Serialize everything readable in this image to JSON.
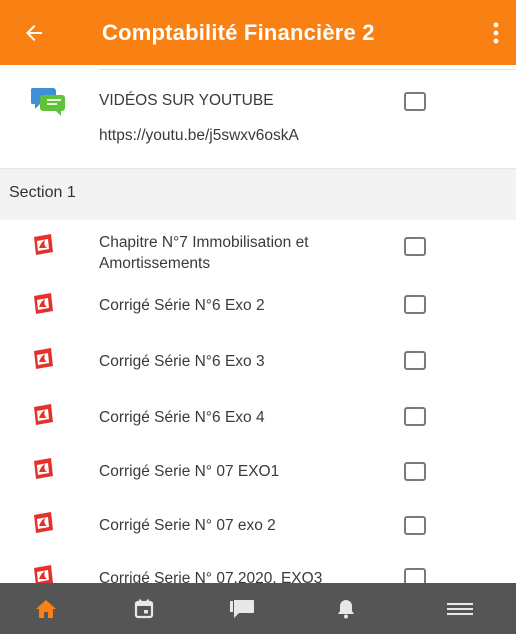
{
  "header": {
    "title": "Comptabilité Financière 2"
  },
  "colors": {
    "accent": "#f98012",
    "nav_bg": "#555555",
    "nav_active": "#f98012",
    "nav_inactive": "#e8e8e8"
  },
  "top_item": {
    "icon": "chat-bubbles-icon",
    "title": "VIDÉOS SUR YOUTUBE",
    "url": "https://youtu.be/j5swxv6oskA"
  },
  "section": {
    "label": "Section 1"
  },
  "items": [
    {
      "icon": "pdf-icon",
      "title": "Chapitre N°7 Immobilisation et Amortissements"
    },
    {
      "icon": "pdf-icon",
      "title": "Corrigé Série N°6 Exo 2"
    },
    {
      "icon": "pdf-icon",
      "title": "Corrigé Série N°6 Exo 3"
    },
    {
      "icon": "pdf-icon",
      "title": "Corrigé Série N°6 Exo 4"
    },
    {
      "icon": "pdf-icon",
      "title": "Corrigé Serie N° 07 EXO1"
    },
    {
      "icon": "pdf-icon",
      "title": "Corrigé Serie N° 07 exo 2"
    },
    {
      "icon": "pdf-icon",
      "title": "Corrigé Serie N° 07.2020. EXO3"
    }
  ],
  "bottom_nav": [
    {
      "icon": "home-icon",
      "active": true
    },
    {
      "icon": "calendar-icon",
      "active": false
    },
    {
      "icon": "messages-icon",
      "active": false
    },
    {
      "icon": "bell-icon",
      "active": false
    },
    {
      "icon": "menu-icon",
      "active": false
    }
  ]
}
